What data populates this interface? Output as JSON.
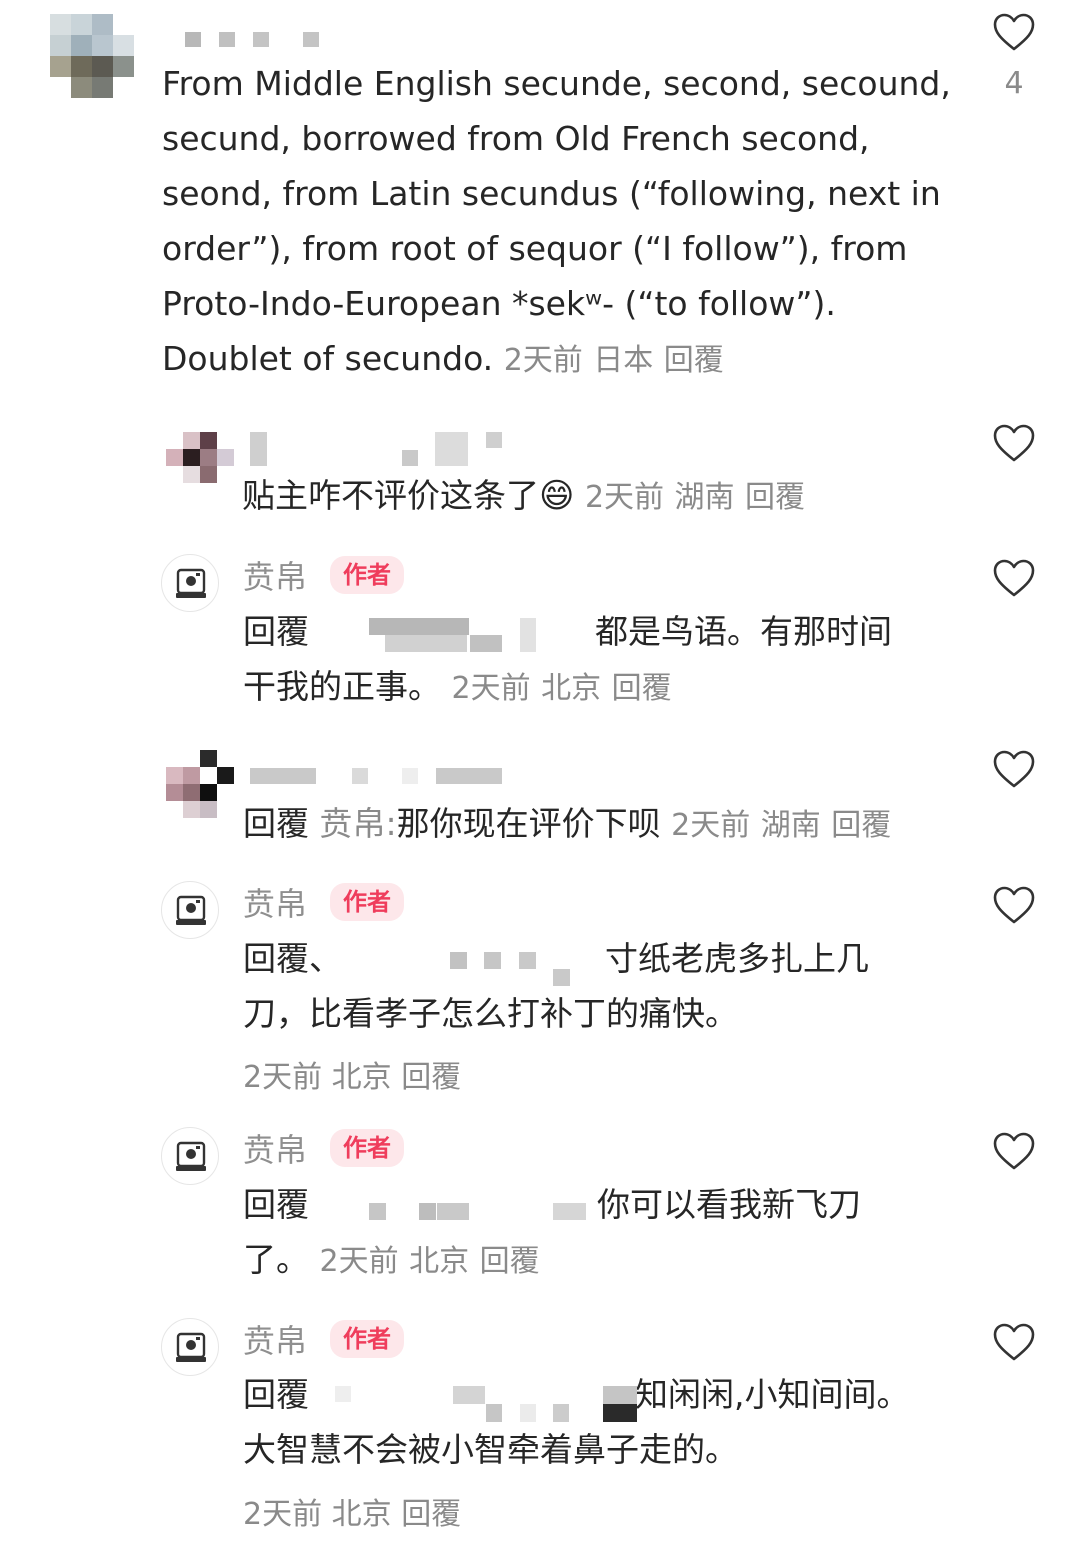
{
  "comments": [
    {
      "username": "",
      "text_lines": [
        "From Middle English secunde, second, secound,",
        "secund, borrowed from Old French second,",
        "seond, from Latin secundus (“following, next in",
        "order”), from root of sequor (“I follow”), from",
        "Proto-Indo-European *sekʷ- (“to follow”).",
        "Doublet of secundo."
      ],
      "time": "2天前",
      "location": "日本",
      "reply": "回覆",
      "likes": "4"
    },
    {
      "username": "",
      "text": "贴主咋不评价这条了",
      "emoji": "😄",
      "time": "2天前",
      "location": "湖南",
      "reply": "回覆"
    },
    {
      "username": "贲帛",
      "badge": "作者",
      "line1_prefix": "回覆",
      "line1_suffix": "都是鸟语。有那时间",
      "line2": "干我的正事。",
      "time": "2天前",
      "location": "北京",
      "reply": "回覆"
    },
    {
      "username": "",
      "prefix": "回覆",
      "reply_to": "贲帛:",
      "text": "那你现在评价下呗",
      "time": "2天前",
      "location": "湖南",
      "reply": "回覆"
    },
    {
      "username": "贲帛",
      "badge": "作者",
      "line1_prefix": "回覆、",
      "line1_suffix": "寸纸老虎多扎上几",
      "line2": "刀，比看孝子怎么打补丁的痛快。",
      "time": "2天前",
      "location": "北京",
      "reply": "回覆"
    },
    {
      "username": "贲帛",
      "badge": "作者",
      "line1_prefix": "回覆",
      "line1_suffix": "你可以看我新飞刀",
      "line2": "了。",
      "time": "2天前",
      "location": "北京",
      "reply": "回覆"
    },
    {
      "username": "贲帛",
      "badge": "作者",
      "line1_prefix": "回覆",
      "line1_suffix": "知闲闲,小知间间。",
      "line2": "大智慧不会被小智牵着鼻子走的。",
      "time": "2天前",
      "location": "北京",
      "reply": "回覆"
    }
  ],
  "icons": {
    "like": "heart-outline-icon",
    "author_avatar": "camera-icon"
  },
  "colors": {
    "text": "#262626",
    "meta": "#8a8a8a",
    "badge_bg": "#fde7ea",
    "badge_text": "#ef3d5c"
  }
}
